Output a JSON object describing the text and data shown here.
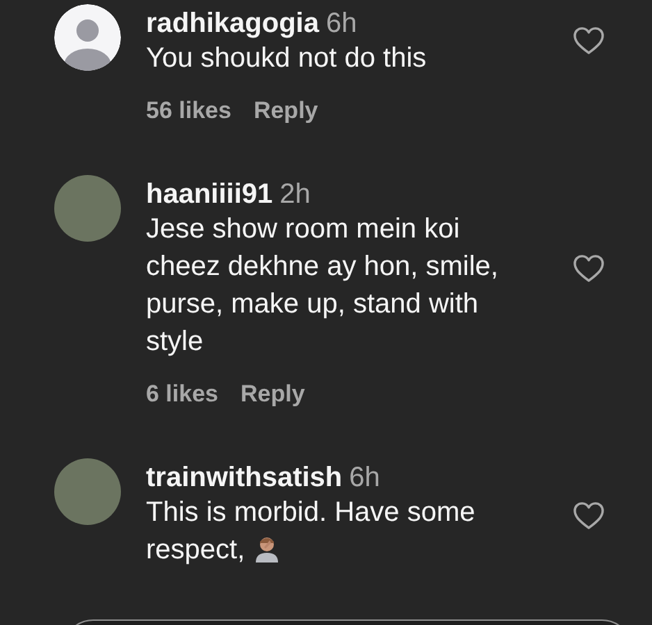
{
  "comments": [
    {
      "avatar": {
        "kind": "default"
      },
      "username": "radhikagogia",
      "time": "6h",
      "text": "You shoukd not do this",
      "emoji": false,
      "likes": "56 likes",
      "reply": "Reply",
      "liked": false
    },
    {
      "avatar": {
        "kind": "photo"
      },
      "username": "haaniiii91",
      "time": "2h",
      "text": "Jese show room mein koi cheez dekhne ay hon, smile, purse, make up, stand with style",
      "emoji": false,
      "likes": "6 likes",
      "reply": "Reply",
      "liked": false
    },
    {
      "avatar": {
        "kind": "photo"
      },
      "username": "trainwithsatish",
      "time": "6h",
      "text": "This is morbid. Have some respect,",
      "emoji": true,
      "liked": false
    }
  ],
  "comment_field": {
    "visible": true
  }
}
